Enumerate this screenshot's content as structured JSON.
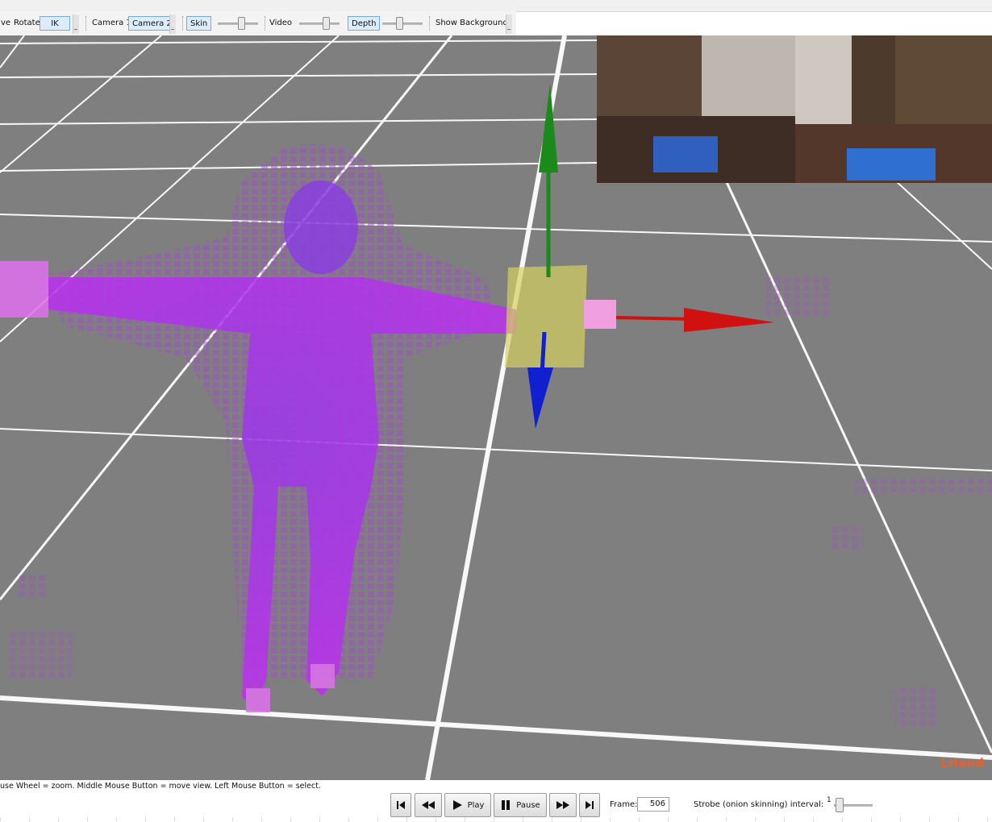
{
  "toolbar": {
    "move_label": "ve",
    "rotate_label": "Rotate",
    "ik_label": "IK",
    "camera1_label": "Camera 1",
    "camera2_label": "Camera 2",
    "skin_label": "Skin",
    "video_label": "Video",
    "depth_label": "Depth",
    "show_background_label": "Show Background",
    "skin_slider_level": 0.62,
    "video_slider_level": 0.7,
    "depth_slider_level": 0.42
  },
  "viewport": {
    "selected_joint_label": "LHand",
    "colors": {
      "background": "#7f7f7f",
      "grid": "#ffffff",
      "body": "#c030f0",
      "y_axis": "#1a8a1a",
      "x_axis": "#d11010",
      "z_axis": "#1020d0",
      "gizmo_box": "#d4d060",
      "label": "#e8602c"
    }
  },
  "status_text": "use Wheel = zoom. Middle Mouse Button = move view. Left Mouse Button = select.",
  "playback": {
    "first_icon": "skip-to-start-icon",
    "rewind_icon": "rewind-icon",
    "play_label": "Play",
    "pause_label": "Pause",
    "forward_icon": "fast-forward-icon",
    "last_icon": "skip-to-end-icon",
    "frame_label": "Frame:",
    "frame_value": "506",
    "strobe_label": "Strobe (onion skinning) interval:",
    "strobe_value": "1"
  }
}
